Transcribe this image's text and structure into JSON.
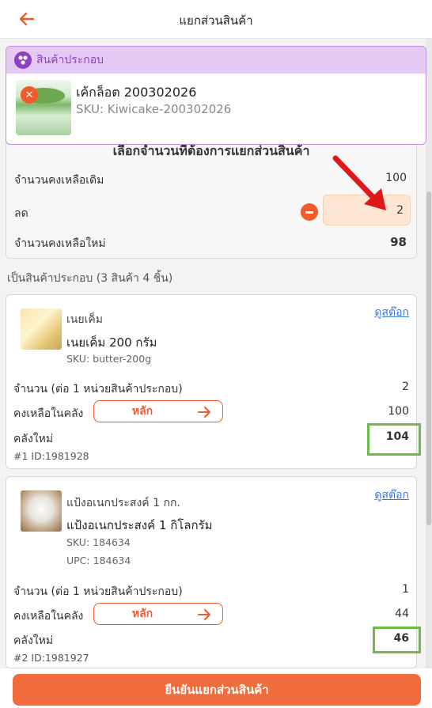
{
  "header": {
    "title": "แยกส่วนสินค้า"
  },
  "composite": {
    "section_label": "สินค้าประกอบ",
    "name": "เค้กล็อต 200302026",
    "sku": "SKU: Kiwicake-200302026"
  },
  "quantity": {
    "heading": "เลือกจำนวนที่ต้องการแยกส่วนสินค้า",
    "original_label": "จำนวนคงเหลือเดิม",
    "original_value": "100",
    "reduce_label": "ลด",
    "reduce_value": "2",
    "new_label": "จำนวนคงเหลือใหม่",
    "new_value": "98"
  },
  "components_title": "เป็นสินค้าประกอบ (3 สินค้า 4 ชิ้น)",
  "components": [
    {
      "short_name": "เนยเค็ม",
      "full_name": "เนยเค็ม 200 กรัม",
      "sku": "SKU: butter-200g",
      "upc": "",
      "view_stock": "ดูสต๊อก",
      "per_unit_label": "จำนวน (ต่อ 1 หน่วยสินค้าประกอบ)",
      "per_unit_value": "2",
      "in_stock_label": "คงเหลือในคลัง",
      "deduct_label": "หลัก",
      "in_stock_value": "100",
      "new_stock_label": "คลังใหม่",
      "new_stock_value": "104",
      "id_text": "#1 ID:1981928"
    },
    {
      "short_name": "แป้งอเนกประสงค์ 1 กก.",
      "full_name": "แป้งอเนกประสงค์ 1 กิโลกรัม",
      "sku": "SKU: 184634",
      "upc": "UPC: 184634",
      "view_stock": "ดูสต๊อก",
      "per_unit_label": "จำนวน (ต่อ 1 หน่วยสินค้าประกอบ)",
      "per_unit_value": "1",
      "in_stock_label": "คงเหลือในคลัง",
      "deduct_label": "หลัก",
      "in_stock_value": "44",
      "new_stock_label": "คลังใหม่",
      "new_stock_value": "46",
      "id_text": "#2 ID:1981927"
    }
  ],
  "confirm_label": "ยืนยันแยกส่วนสินค้า",
  "colors": {
    "accent": "#f15a29",
    "purple": "#8e3fc4",
    "highlight": "#6dbb4a",
    "link": "#3b78d8"
  }
}
